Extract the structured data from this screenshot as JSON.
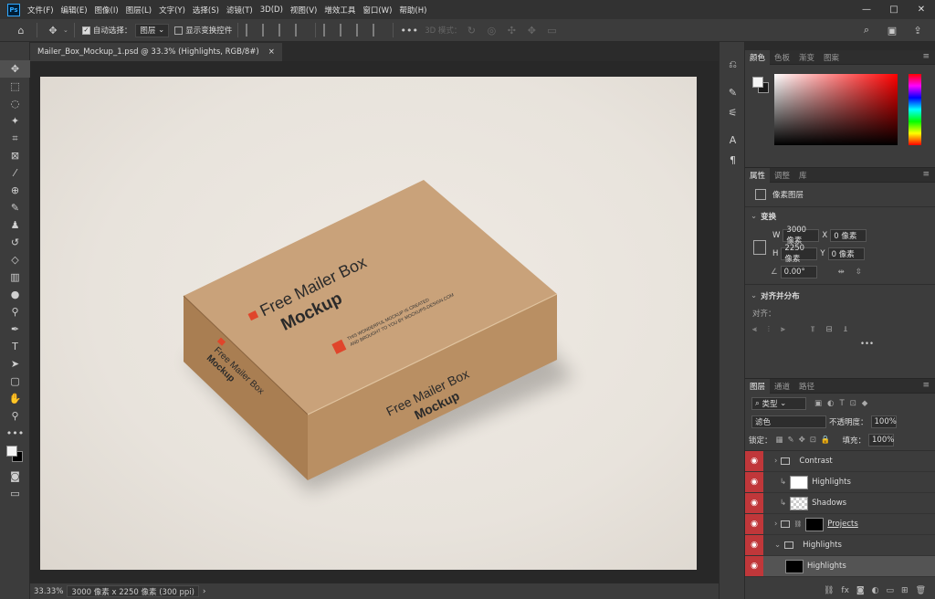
{
  "app": {
    "logo": "Ps"
  },
  "menu": [
    "文件(F)",
    "编辑(E)",
    "图像(I)",
    "图层(L)",
    "文字(Y)",
    "选择(S)",
    "滤镜(T)",
    "3D(D)",
    "视图(V)",
    "增效工具",
    "窗口(W)",
    "帮助(H)"
  ],
  "window_controls": {
    "minimize": "—",
    "maximize": "□",
    "close": "✕"
  },
  "options": {
    "auto_select_label": "自动选择：",
    "auto_select_value": "图层",
    "show_transform_label": "显示变换控件",
    "mode_3d_label": "3D 模式："
  },
  "document_tab": {
    "title": "Mailer_Box_Mockup_1.psd @ 33.3% (Highlights, RGB/8#)",
    "close": "×"
  },
  "status": {
    "zoom": "33.33%",
    "info": "3000 像素 x 2250 像素 (300 ppi)",
    "arrow": "›"
  },
  "color_panel": {
    "tabs": [
      "颜色",
      "色板",
      "渐变",
      "图案"
    ]
  },
  "props_panel": {
    "tabs": [
      "属性",
      "调整",
      "库"
    ],
    "layer_kind": "像素图层",
    "transform_title": "变换",
    "w_label": "W",
    "w_value": "3000 像素",
    "x_label": "X",
    "x_value": "0 像素",
    "h_label": "H",
    "h_value": "2250 像素",
    "y_label": "Y",
    "y_value": "0 像素",
    "angle_value": "0.00°",
    "align_title": "对齐并分布",
    "align_label": "对齐：",
    "more": "•••"
  },
  "layers_panel": {
    "tabs": [
      "图层",
      "通道",
      "路径"
    ],
    "kind_filter": "类型",
    "blend_mode": "滤色",
    "opacity_label": "不透明度：",
    "opacity_value": "100%",
    "lock_label": "锁定：",
    "fill_label": "填充：",
    "fill_value": "100%",
    "layers": [
      {
        "name": "Contrast"
      },
      {
        "name": "Highlights"
      },
      {
        "name": "Shadows"
      },
      {
        "name": "Projects"
      },
      {
        "name": "Highlights"
      },
      {
        "name": "Highlights"
      }
    ]
  },
  "mockup": {
    "top_title": "Free Mailer Box",
    "top_subtitle": "Mockup",
    "top_small_1": "THIS WONDERFUL MOCKUP IS CREATED",
    "top_small_2": "AND BROUGHT TO YOU BY MOCKUPS-DESIGN.COM",
    "front_title": "Free Mailer Box",
    "front_subtitle": "Mockup",
    "side_title": "Free Mailer Box",
    "side_subtitle": "Mockup"
  },
  "colors": {
    "box_top": "#c9a27a",
    "box_front": "#b98f63",
    "box_side": "#a97e52",
    "logo_red": "#e0452b",
    "eye_red": "#c0373a"
  }
}
